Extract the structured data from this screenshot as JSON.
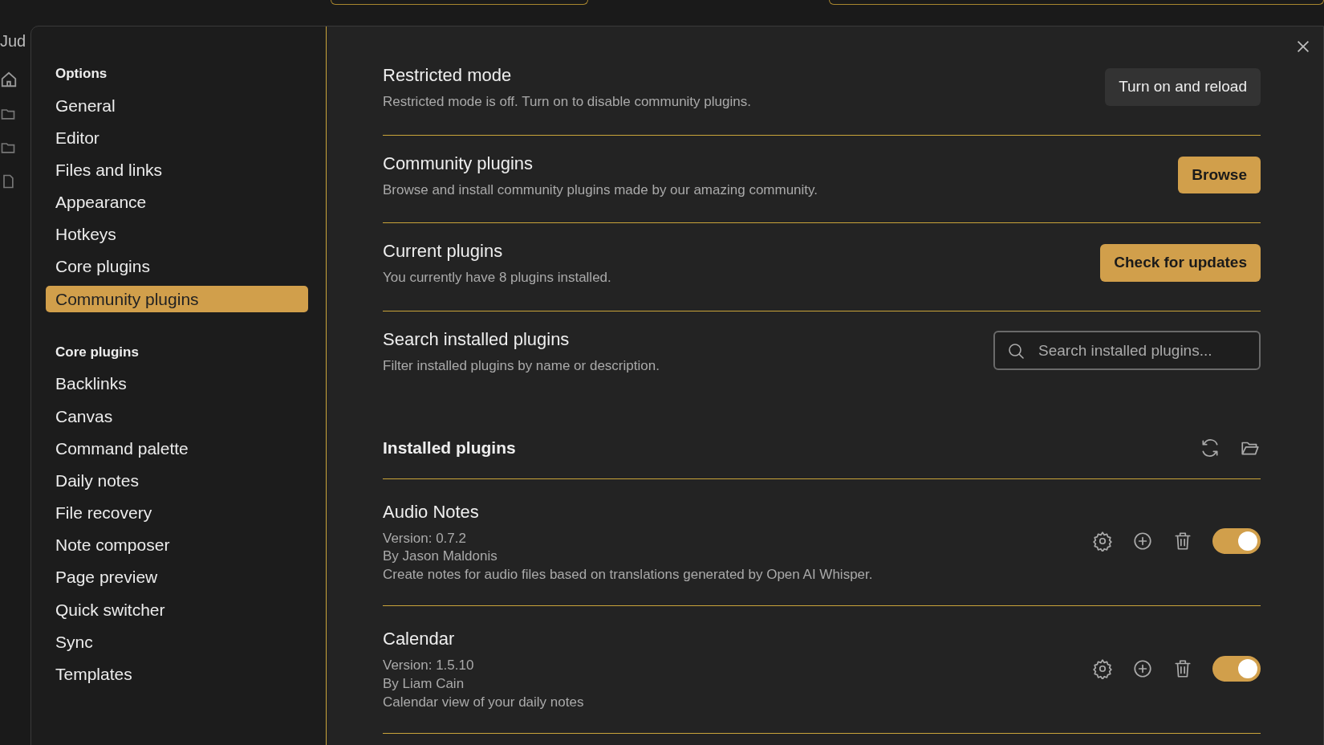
{
  "background_app": {
    "vault_name": "Jud"
  },
  "sidebar": {
    "sections": [
      {
        "heading": "Options",
        "items": [
          {
            "label": "General",
            "selected": false
          },
          {
            "label": "Editor",
            "selected": false
          },
          {
            "label": "Files and links",
            "selected": false
          },
          {
            "label": "Appearance",
            "selected": false
          },
          {
            "label": "Hotkeys",
            "selected": false
          },
          {
            "label": "Core plugins",
            "selected": false
          },
          {
            "label": "Community plugins",
            "selected": true
          }
        ]
      },
      {
        "heading": "Core plugins",
        "items": [
          {
            "label": "Backlinks",
            "selected": false
          },
          {
            "label": "Canvas",
            "selected": false
          },
          {
            "label": "Command palette",
            "selected": false
          },
          {
            "label": "Daily notes",
            "selected": false
          },
          {
            "label": "File recovery",
            "selected": false
          },
          {
            "label": "Note composer",
            "selected": false
          },
          {
            "label": "Page preview",
            "selected": false
          },
          {
            "label": "Quick switcher",
            "selected": false
          },
          {
            "label": "Sync",
            "selected": false
          },
          {
            "label": "Templates",
            "selected": false
          }
        ]
      }
    ]
  },
  "settings": [
    {
      "kind": "button",
      "title": "Restricted mode",
      "description": "Restricted mode is off. Turn on to disable community plugins.",
      "button": {
        "label": "Turn on and reload",
        "primary": false
      }
    },
    {
      "kind": "button",
      "title": "Community plugins",
      "description": "Browse and install community plugins made by our amazing community.",
      "button": {
        "label": "Browse",
        "primary": true
      }
    },
    {
      "kind": "button",
      "title": "Current plugins",
      "description": "You currently have 8 plugins installed.",
      "button": {
        "label": "Check for updates",
        "primary": true
      }
    },
    {
      "kind": "search",
      "title": "Search installed plugins",
      "description": "Filter installed plugins by name or description.",
      "placeholder": "Search installed plugins..."
    }
  ],
  "installed": {
    "heading": "Installed plugins",
    "plugins": [
      {
        "name": "Audio Notes",
        "version": "Version: 0.7.2",
        "author": "By Jason Maldonis",
        "description": "Create notes for audio files based on translations generated by Open AI Whisper.",
        "enabled": true
      },
      {
        "name": "Calendar",
        "version": "Version: 1.5.10",
        "author": "By Liam Cain",
        "description": "Calendar view of your daily notes",
        "enabled": true
      }
    ]
  }
}
